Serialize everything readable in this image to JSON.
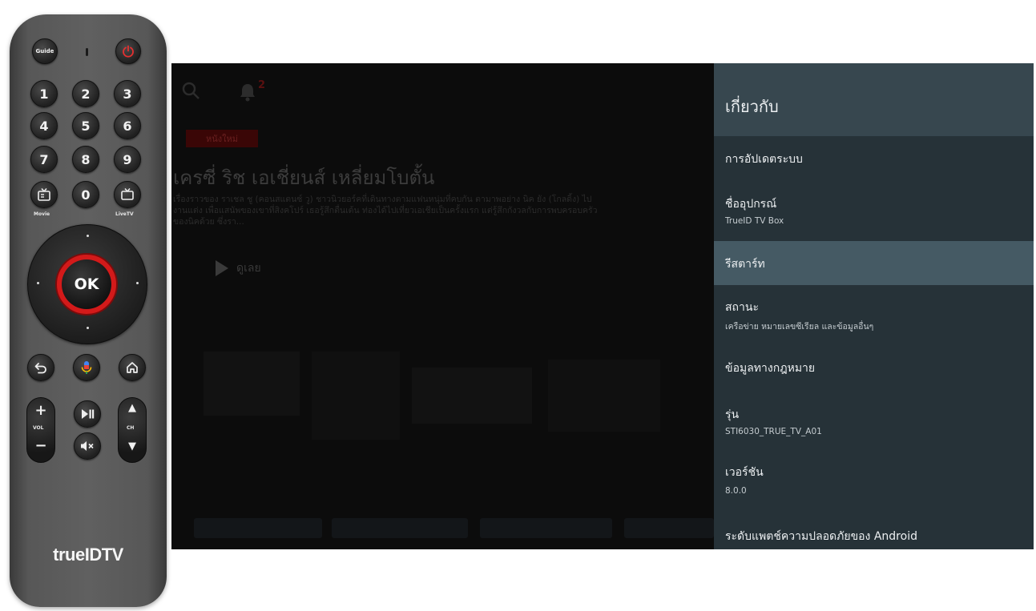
{
  "remote": {
    "guide_label": "Guide",
    "digits": [
      "1",
      "2",
      "3",
      "4",
      "5",
      "6",
      "7",
      "8",
      "9",
      "0"
    ],
    "movie_label": "Movie",
    "livetv_label": "LiveTV",
    "ok_label": "OK",
    "vol_label": "VOL",
    "ch_label": "CH",
    "brand": "trueIDTV",
    "accent_color": "#d31a1a"
  },
  "tv": {
    "notification_count": "2",
    "new_tag": "หนังใหม่",
    "movie_title": "เครซี่ ริช เอเชี่ยนส์ เหลี่ยมโบตั้น",
    "movie_description": "เรื่องราวของ ราเชล ชู (คอนสแตนซ์ วู) ชาวนิวยอร์คที่เดินทางตามแฟนหนุ่มที่คบกัน ตามาพอย่าง นิค ยัง (โกลดิ้ง) ไปงานแต่ง เพื่อแสนัพของเขาที่สิงคโปร์ เธอรู้สึกตื่นเต้น ท่องได้ไปเที่ยวเอเชียเป็นครั้งแรก แต่รู้สึกกังวลกับการพบครอบครัวของนิคด้วย ซึ่งรา...",
    "play_label": "ดูเลย"
  },
  "settings": {
    "title": "เกี่ยวกับ",
    "items": [
      {
        "label": "การอัปเดตระบบ",
        "sub": ""
      },
      {
        "label": "ชื่ออุปกรณ์",
        "sub": "TrueID TV Box"
      },
      {
        "label": "รีสตาร์ท",
        "sub": "",
        "selected": true
      },
      {
        "label": "สถานะ",
        "sub": "เครือข่าย หมายเลขซีเรียล และข้อมูลอื่นๆ"
      },
      {
        "label": "ข้อมูลทางกฎหมาย",
        "sub": ""
      },
      {
        "label": "รุ่น",
        "sub": "STI6030_TRUE_TV_A01"
      },
      {
        "label": "เวอร์ชัน",
        "sub": "8.0.0"
      },
      {
        "label": "ระดับแพตช์ความปลอดภัยของ Android",
        "sub": ""
      }
    ],
    "colors": {
      "panel_bg": "#263238",
      "header_bg": "#37474f",
      "selected_bg": "#455a64"
    }
  }
}
